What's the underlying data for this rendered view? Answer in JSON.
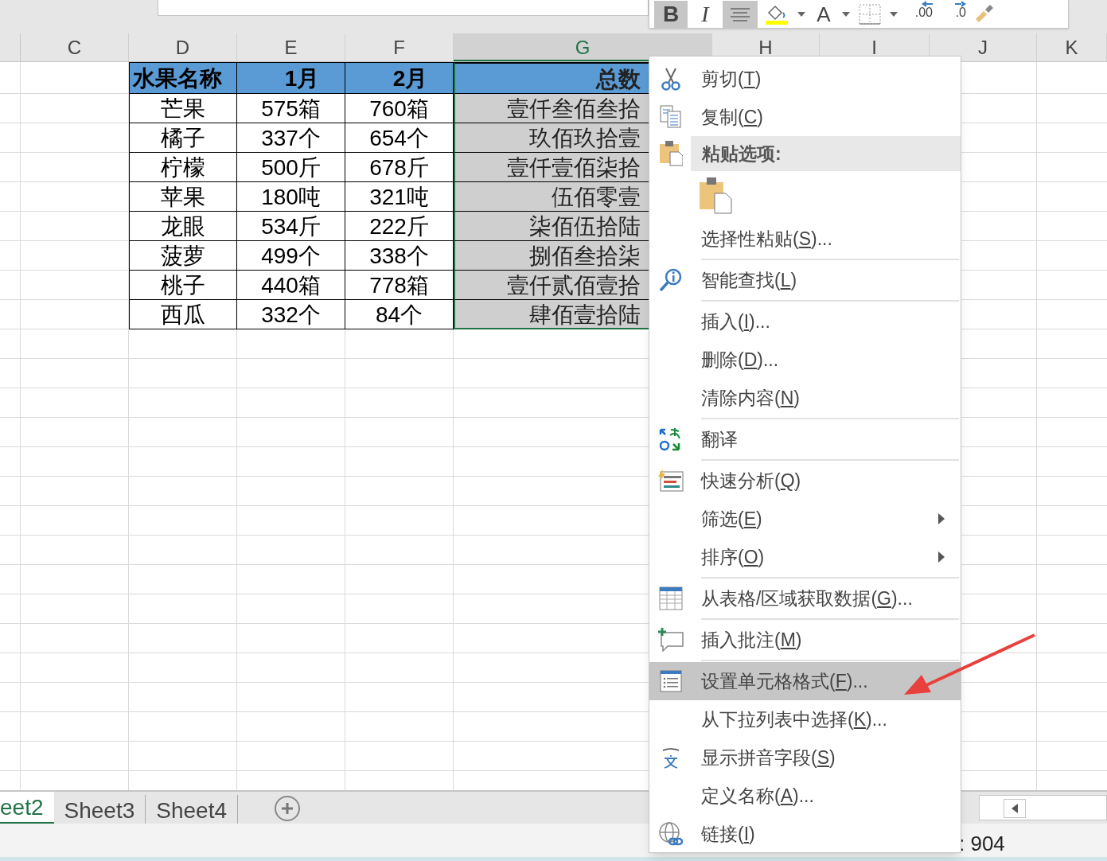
{
  "mini_toolbar": [
    {
      "kind": "bold",
      "label": "B",
      "selected": true
    },
    {
      "kind": "italic",
      "label": "I",
      "selected": false
    },
    {
      "kind": "align",
      "selected": true
    },
    {
      "kind": "fill",
      "selected": false
    },
    {
      "kind": "dropdown",
      "selected": false
    },
    {
      "kind": "font_color",
      "label": "A",
      "selected": false
    },
    {
      "kind": "dropdown",
      "selected": false
    },
    {
      "kind": "borders",
      "selected": false
    },
    {
      "kind": "dropdown",
      "selected": false
    },
    {
      "kind": "increase_decimal",
      "bottom": ".00",
      "selected": false
    },
    {
      "kind": "decrease_decimal",
      "bottom": ".0",
      "selected": false
    },
    {
      "kind": "brush",
      "selected": false
    }
  ],
  "columns": [
    {
      "label": "C",
      "selected": false
    },
    {
      "label": "D",
      "selected": false
    },
    {
      "label": "E",
      "selected": false
    },
    {
      "label": "F",
      "selected": false
    },
    {
      "label": "G",
      "selected": true
    },
    {
      "label": "H",
      "selected": false
    },
    {
      "label": "I",
      "selected": false
    },
    {
      "label": "J",
      "selected": false
    },
    {
      "label": "K",
      "selected": false
    }
  ],
  "table": {
    "header": [
      "水果名称",
      "1月",
      "2月",
      "总数"
    ],
    "rows": [
      [
        "芒果",
        "575箱",
        "760箱",
        "壹仟叁佰叁拾"
      ],
      [
        "橘子",
        "337个",
        "654个",
        "玖佰玖拾壹"
      ],
      [
        "柠檬",
        "500斤",
        "678斤",
        "壹仟壹佰柒拾"
      ],
      [
        "苹果",
        "180吨",
        "321吨",
        "伍佰零壹"
      ],
      [
        "龙眼",
        "534斤",
        "222斤",
        "柒佰伍拾陆"
      ],
      [
        "菠萝",
        "499个",
        "338个",
        "捌佰叁拾柒"
      ],
      [
        "桃子",
        "440箱",
        "778箱",
        "壹仟贰佰壹拾"
      ],
      [
        "西瓜",
        "332个",
        "84个",
        "肆佰壹拾陆"
      ]
    ]
  },
  "sheet_tabs": [
    {
      "label": "eet2",
      "selected": true
    },
    {
      "label": "Sheet3",
      "selected": false
    },
    {
      "label": "Sheet4",
      "selected": false
    }
  ],
  "status_bar": {
    "text": ": 904"
  },
  "context_menu": [
    {
      "kind": "item",
      "label": "剪切(T)",
      "submenu": false,
      "highlighted": false,
      "separator_after": false
    },
    {
      "kind": "item",
      "label": "复制(C)",
      "submenu": false,
      "highlighted": false,
      "separator_after": false
    },
    {
      "kind": "header",
      "label": "粘贴选项:",
      "submenu": false,
      "highlighted": false,
      "separator_after": false
    },
    {
      "kind": "paste_option",
      "submenu": false,
      "highlighted": false,
      "separator_after": false
    },
    {
      "kind": "item",
      "label": "选择性粘贴(S)...",
      "submenu": false,
      "highlighted": false,
      "separator_after": true
    },
    {
      "kind": "item",
      "label": "智能查找(L)",
      "submenu": false,
      "highlighted": false,
      "separator_after": true
    },
    {
      "kind": "item",
      "label": "插入(I)...",
      "submenu": false,
      "highlighted": false,
      "separator_after": false
    },
    {
      "kind": "item",
      "label": "删除(D)...",
      "submenu": false,
      "highlighted": false,
      "separator_after": false
    },
    {
      "kind": "item",
      "label": "清除内容(N)",
      "submenu": false,
      "highlighted": false,
      "separator_after": true
    },
    {
      "kind": "item",
      "label": "翻译",
      "submenu": false,
      "highlighted": false,
      "separator_after": true
    },
    {
      "kind": "item",
      "label": "快速分析(Q)",
      "submenu": false,
      "highlighted": false,
      "separator_after": false
    },
    {
      "kind": "item",
      "label": "筛选(E)",
      "submenu": true,
      "highlighted": false,
      "separator_after": false
    },
    {
      "kind": "item",
      "label": "排序(O)",
      "submenu": true,
      "highlighted": false,
      "separator_after": true
    },
    {
      "kind": "item",
      "label": "从表格/区域获取数据(G)...",
      "submenu": false,
      "highlighted": false,
      "separator_after": true
    },
    {
      "kind": "item",
      "label": "插入批注(M)",
      "submenu": false,
      "highlighted": false,
      "separator_after": true
    },
    {
      "kind": "item",
      "label": "设置单元格格式(F)...",
      "submenu": false,
      "highlighted": true,
      "separator_after": false
    },
    {
      "kind": "item",
      "label": "从下拉列表中选择(K)...",
      "submenu": false,
      "highlighted": false,
      "separator_after": false
    },
    {
      "kind": "item",
      "label": "显示拼音字段(S)",
      "submenu": false,
      "highlighted": false,
      "separator_after": false
    },
    {
      "kind": "item",
      "label": "定义名称(A)...",
      "submenu": false,
      "highlighted": false,
      "separator_after": false
    },
    {
      "kind": "item",
      "label": "链接(I)",
      "submenu": false,
      "highlighted": false,
      "separator_after": false
    }
  ],
  "annotation": {
    "kind": "arrow"
  }
}
